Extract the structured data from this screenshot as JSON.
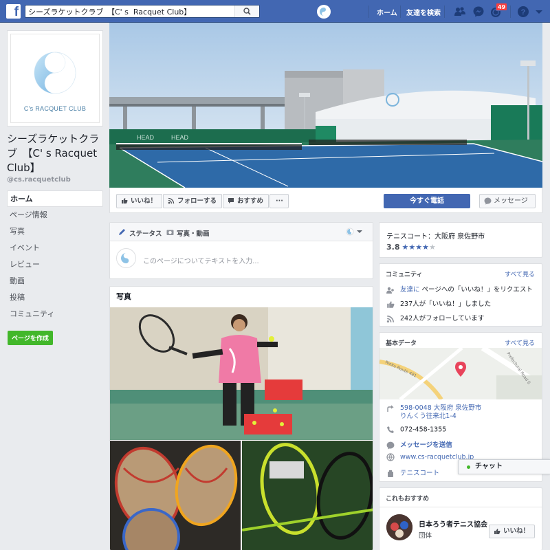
{
  "topbar": {
    "search_value": "シーズラケットクラブ　【C' s  Racquet Club】",
    "home_label": "ホーム",
    "find_friends_label": "友達を検索",
    "notification_count": "49"
  },
  "profile": {
    "logo_text": "C's RACQUET CLUB",
    "name": "シーズラケットクラブ　【C' s Racquet Club】",
    "handle": "@cs.racquetclub"
  },
  "nav": {
    "items": [
      "ホーム",
      "ページ情報",
      "写真",
      "イベント",
      "レビュー",
      "動画",
      "投稿",
      "コミュニティ"
    ],
    "create_page": "ページを作成"
  },
  "actions": {
    "like": "いいね！",
    "follow": "フォローする",
    "recommend": "おすすめ",
    "more": "···",
    "call_now": "今すぐ電話",
    "message": "メッセージ"
  },
  "composer": {
    "tab_status": "ステータス",
    "tab_photo": "写真・動画",
    "placeholder": "このページについてテキストを入力..."
  },
  "photos": {
    "title": "写真"
  },
  "rating_card": {
    "category": "テニスコート：大阪府 泉佐野市",
    "rating": "3.8",
    "rating_value": 3.8,
    "rating_max": 5
  },
  "community": {
    "title": "コミュニティ",
    "see_all": "すべて見る",
    "invite_link": "友達に",
    "invite_text": " ページへの「いいね！」をリクエスト",
    "likes": "237人が「いいね！」しました",
    "follows": "242人がフォローしています"
  },
  "about": {
    "title": "基本データ",
    "see_all": "すべて見る",
    "map_road_1": "Rinku Route 481",
    "map_road_2": "Prefectural Road 6",
    "address_line1": "598-0048 大阪府 泉佐野市",
    "address_line2": "りんくう往来北1-4",
    "phone": "072-458-1355",
    "send_message": "メッセージを送信",
    "website": "www.cs-racquetclub.jp",
    "category": "テニスコート"
  },
  "recommend": {
    "title": "これもおすすめ",
    "page_name": "日本ろう者テニス協会",
    "page_type": "団体",
    "like_label": "いいね！"
  },
  "chat": {
    "label": "チャット"
  },
  "colors": {
    "facebook_blue": "#4267b2",
    "background": "#e9ebee",
    "green": "#42b72a",
    "badge_red": "#fa3e3e"
  }
}
